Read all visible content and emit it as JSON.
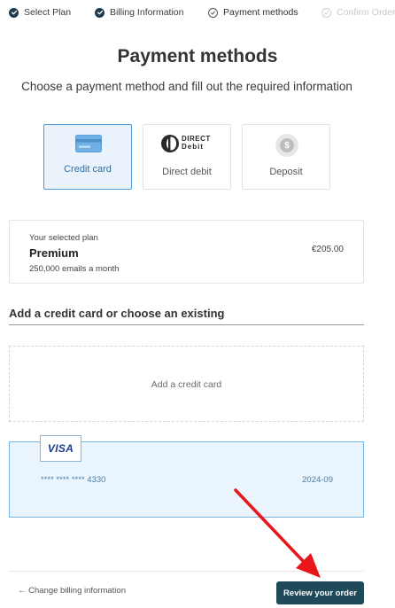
{
  "steps": [
    {
      "label": "Select Plan",
      "status": "done"
    },
    {
      "label": "Billing Information",
      "status": "done"
    },
    {
      "label": "Payment methods",
      "status": "current"
    },
    {
      "label": "Confirm Order",
      "status": "future"
    }
  ],
  "page": {
    "title": "Payment methods",
    "subtitle": "Choose a payment method and fill out the required information"
  },
  "methods": [
    {
      "label": "Credit card",
      "selected": true,
      "icon": "credit-card-icon"
    },
    {
      "label": "Direct debit",
      "selected": false,
      "icon": "direct-debit-logo",
      "logo_text_1": "DIRECT",
      "logo_text_2": "Debit"
    },
    {
      "label": "Deposit",
      "selected": false,
      "icon": "dollar-coin-icon",
      "symbol": "$"
    }
  ],
  "plan": {
    "key_label": "Your selected plan",
    "name": "Premium",
    "description": "250,000 emails a month",
    "price": "€205.00"
  },
  "cards_section": {
    "title": "Add a credit card or choose an existing",
    "add_label": "Add a credit card",
    "saved": [
      {
        "brand": "VISA",
        "number": "**** **** **** 4330",
        "expiry": "2024-09"
      }
    ]
  },
  "footer": {
    "back_label": "← Change billing information",
    "review_label": "Review your order"
  },
  "colors": {
    "accent": "#4e9ad6",
    "selected_bg": "#eaf3fb",
    "primary_button": "#1f4a5a",
    "annotation_arrow": "#e8161b"
  }
}
